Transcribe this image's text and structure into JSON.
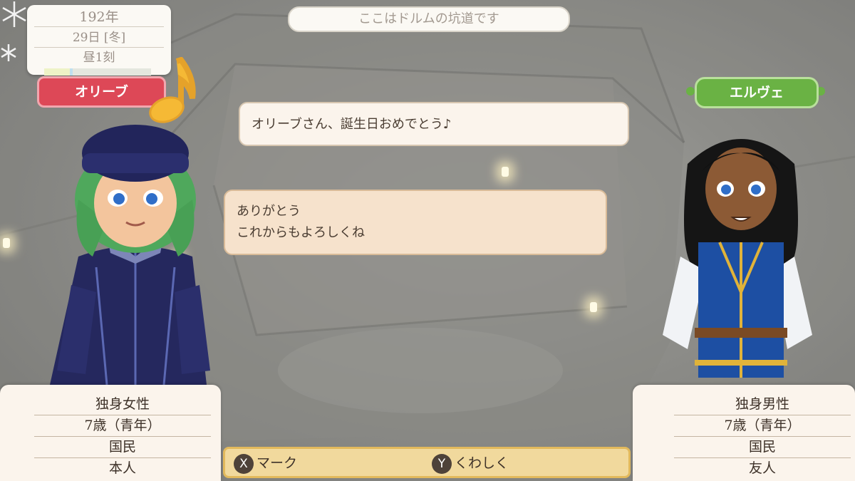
{
  "calendar": {
    "year": "192年",
    "day": "29日 [冬]",
    "time": "昼1刻"
  },
  "location": "ここはドルムの坑道です",
  "left_character": {
    "name": "オリーブ",
    "tag_color": "#dd4857",
    "info": [
      "独身女性",
      "7歳（青年）",
      "国民",
      "本人"
    ]
  },
  "right_character": {
    "name": "エルヴェ",
    "tag_color": "#6ab244",
    "info": [
      "独身男性",
      "7歳（青年）",
      "国民",
      "友人"
    ]
  },
  "dialogue": {
    "line1": "オリーブさん、誕生日おめでとう♪",
    "line2a": "ありがとう",
    "line2b": "これからもよろしくね"
  },
  "controls": {
    "x_key": "X",
    "x_label": "マーク",
    "y_key": "Y",
    "y_label": "くわしく"
  },
  "icons": [
    "snowflake-icon",
    "music-note-icon"
  ]
}
